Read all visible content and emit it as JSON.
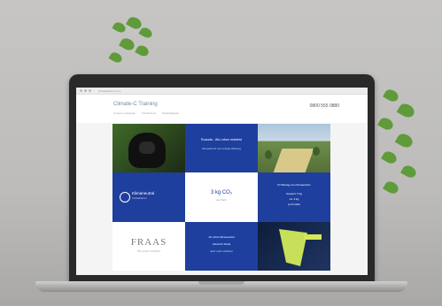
{
  "window": {
    "url": "climatepartner.com"
  },
  "site": {
    "title": "Climate-C Training",
    "nav": [
      "Unsere Leistungen",
      "Klimaschutz",
      "Nachhaltigkeit"
    ],
    "phone": "0800 555 0880"
  },
  "tiles": {
    "gorilla": {
      "alt": "Gorilla"
    },
    "rwanda": {
      "title": "Ruanda - Wo Leben entsteht",
      "text": "Klimaschutz und soziale Wirkung"
    },
    "landscape": {
      "alt": "Landscape"
    },
    "climate": {
      "badge": "Klimaneutral",
      "sub": "ClimatePartner"
    },
    "kg": {
      "value": "3 kg CO₂",
      "sub": "pro Tuch"
    },
    "facts": {
      "title": "Ihr Beitrag zum Klimaschutz",
      "line1": "Gesamt: 3 kg",
      "line2": "ca. 3 kg",
      "line3": "je Produkt"
    },
    "fraas": {
      "brand": "FRAAS",
      "sub": "THE SCARF COMPANY"
    },
    "message": {
      "line1": "Ab sofort klimaneutral",
      "line2": "Schal für Schal",
      "line3": "Jetzt mehr erfahren"
    },
    "scarf": {
      "alt": "Scarf"
    }
  },
  "colors": {
    "brand_blue": "#1e3f9e",
    "accent_green": "#c8df5a"
  }
}
